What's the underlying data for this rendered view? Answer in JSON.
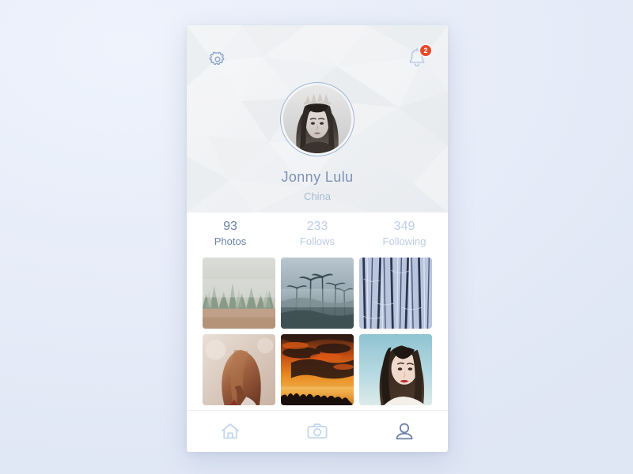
{
  "app": {
    "screen_name": "Profile",
    "background_color": "#e9effa",
    "card_color": "#ffffff",
    "accent_color": "#7e92b4",
    "badge_color": "#e8492a",
    "icon_color": "#c3d6ef",
    "icon_active_color": "#6b82a8"
  },
  "header": {
    "settings_icon": "gear-icon",
    "notifications_icon": "bell-icon",
    "notifications_badge": "2",
    "avatar": {
      "icon": "avatar",
      "alt": "portrait of woman with tiara, black and white"
    },
    "name": "Jonny Lulu",
    "location": "China"
  },
  "stats": [
    {
      "value": "93",
      "label": "Photos",
      "active": true
    },
    {
      "value": "233",
      "label": "Follows",
      "active": false
    },
    {
      "value": "349",
      "label": "Following",
      "active": false
    }
  ],
  "photos": [
    {
      "name": "misty-pine-forest"
    },
    {
      "name": "foggy-palm-trees"
    },
    {
      "name": "frosted-birch-trees"
    },
    {
      "name": "auburn-haired-girl"
    },
    {
      "name": "orange-sunset-clouds"
    },
    {
      "name": "dark-haired-woman-portrait"
    }
  ],
  "navbar": [
    {
      "icon": "home-icon",
      "label": "Home",
      "active": false
    },
    {
      "icon": "camera-icon",
      "label": "Camera",
      "active": false
    },
    {
      "icon": "profile-icon",
      "label": "Profile",
      "active": true
    }
  ]
}
